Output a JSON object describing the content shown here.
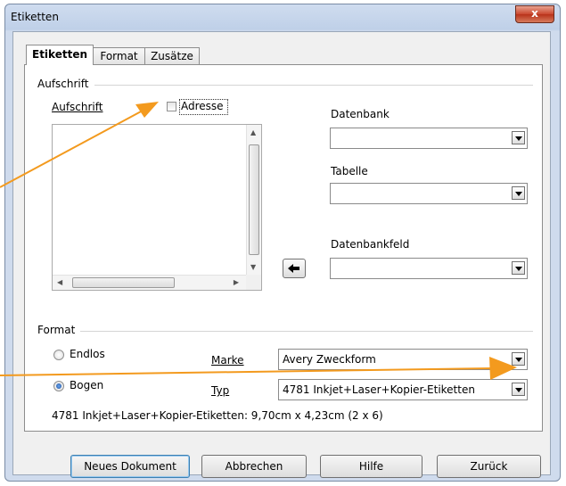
{
  "window": {
    "title": "Etiketten",
    "close_label": "x"
  },
  "tabs": [
    {
      "label": "Etiketten",
      "active": true
    },
    {
      "label": "Format",
      "active": false
    },
    {
      "label": "Zusätze",
      "active": false
    }
  ],
  "inscription": {
    "group_label": "Aufschrift",
    "field_label": "Aufschrift",
    "address_checkbox": {
      "label": "Adresse",
      "checked": false
    },
    "text": ""
  },
  "database": {
    "database_label": "Datenbank",
    "database_value": "",
    "table_label": "Tabelle",
    "table_value": "",
    "field_label": "Datenbankfeld",
    "field_value": ""
  },
  "format": {
    "group_label": "Format",
    "endless_label": "Endlos",
    "sheet_label": "Bogen",
    "selected": "Bogen",
    "brand_label": "Marke",
    "brand_value": "Avery Zweckform",
    "type_label": "Typ",
    "type_value": "4781 Inkjet+Laser+Kopier-Etiketten",
    "info": "4781 Inkjet+Laser+Kopier-Etiketten: 9,70cm x 4,23cm (2 x 6)"
  },
  "buttons": {
    "new_document": "Neues Dokument",
    "cancel": "Abbrechen",
    "help": "Hilfe",
    "back": "Zurück"
  },
  "colors": {
    "annotation_arrow": "#f39a1e"
  }
}
